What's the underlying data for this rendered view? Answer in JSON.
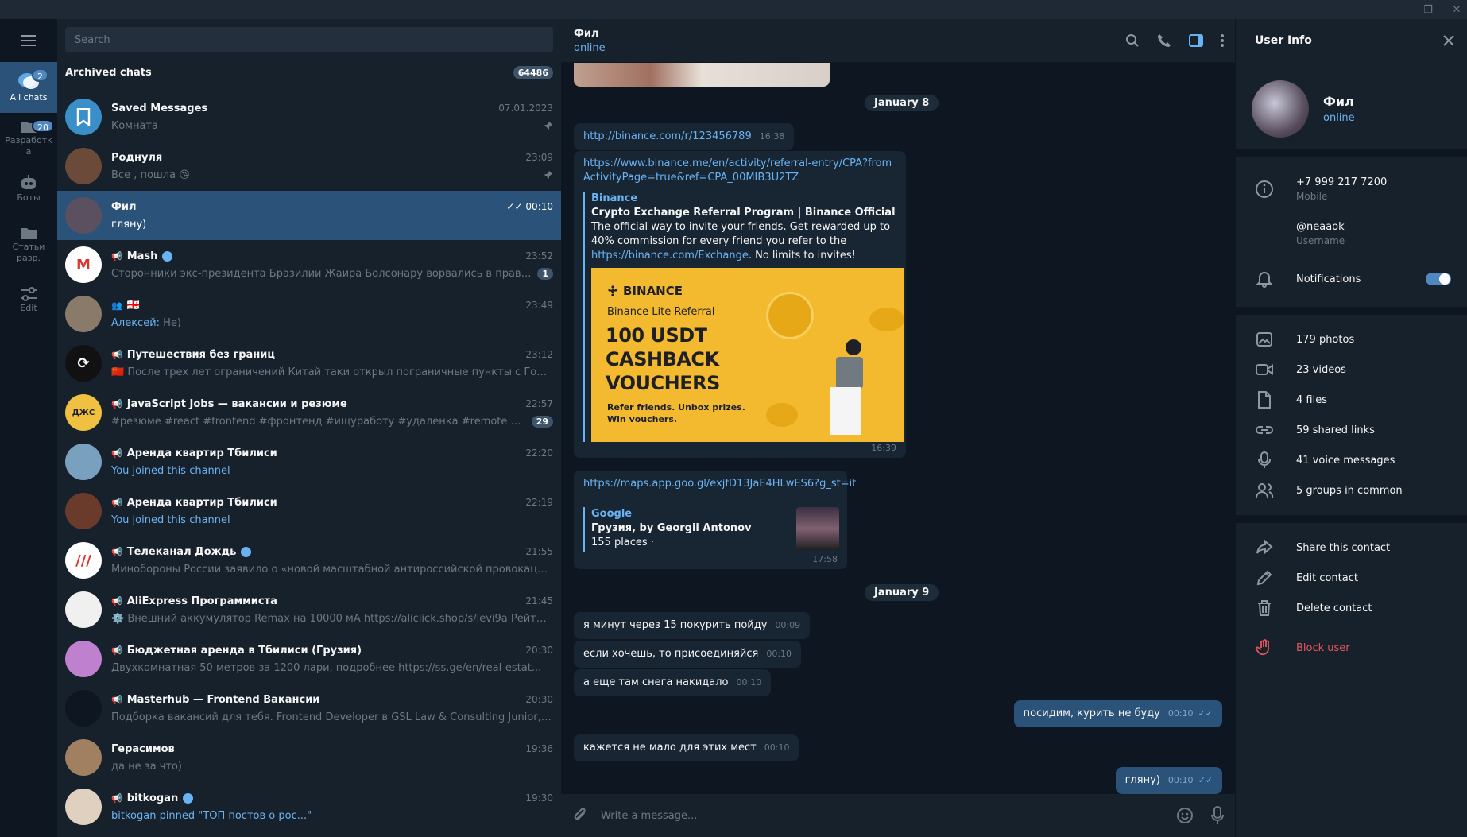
{
  "window": {
    "minimize": "–",
    "maximize": "❐",
    "close": "✕"
  },
  "folders": [
    {
      "label": "All chats",
      "badge": "2",
      "icon": "chats-icon",
      "active": true
    },
    {
      "label": "Разработк а",
      "badge": "20",
      "icon": "folder-icon"
    },
    {
      "label": "Боты",
      "badge": "",
      "icon": "bot-icon"
    },
    {
      "label": "Статьи разр.",
      "badge": "",
      "icon": "folder-icon"
    },
    {
      "label": "Edit",
      "badge": "",
      "icon": "sliders-icon"
    }
  ],
  "search": {
    "placeholder": "Search"
  },
  "archived": {
    "label": "Archived chats",
    "count": "64486"
  },
  "chats": [
    {
      "name": "Saved Messages",
      "time": "07.01.2023",
      "preview": "Комната",
      "pinned": true,
      "avatar_color": "#3a8fc9",
      "avatar_text": "",
      "icon": "bookmark-icon"
    },
    {
      "name": "Роднуля",
      "time": "23:09",
      "preview": "Все , пошла 😘",
      "pinned": true,
      "avatar_color": "#6b4a3a",
      "avatar_text": ""
    },
    {
      "name": "Фил",
      "time": "00:10",
      "preview": "гляну)",
      "selected": true,
      "avatar_color": "#5a5060",
      "avatar_text": "",
      "read": "✓✓"
    },
    {
      "name": "Mash",
      "time": "23:52",
      "preview": "Сторонники экс-президента Бразилии Жаира Болсонару ворвались в правите...",
      "badge": "1",
      "channel": true,
      "verified": true,
      "avatar_color": "#ffffff",
      "avatar_text": "M"
    },
    {
      "name": "🇬🇪",
      "time": "23:49",
      "preview_sender": "Алексей:",
      "preview": " Не)",
      "group": true,
      "avatar_color": "#8a7a6a",
      "avatar_text": ""
    },
    {
      "name": "Путешествия без границ",
      "time": "23:12",
      "preview": "🇨🇳 После трех лет ограничений Китай таки открыл пограничные пункты с Гонконго...",
      "channel": true,
      "avatar_color": "#111111",
      "avatar_text": "⟳"
    },
    {
      "name": "JavaScript Jobs — вакансии и резюме",
      "time": "22:57",
      "preview": "#резюме #react #frontend #фронтенд #ищуработу #удаленка #remote #fulltime ...",
      "badge": "29",
      "channel": true,
      "avatar_color": "#f0c040",
      "avatar_text": "ДЖС"
    },
    {
      "name": "Аренда квартир Тбилиси",
      "time": "22:20",
      "preview": "You joined this channel",
      "preview_blue": true,
      "channel": true,
      "avatar_color": "#7aa0c0",
      "avatar_text": ""
    },
    {
      "name": "Аренда квартир Тбилиси",
      "time": "22:19",
      "preview": "You joined this channel",
      "preview_blue": true,
      "channel": true,
      "avatar_color": "#6a3a2a",
      "avatar_text": ""
    },
    {
      "name": "Телеканал Дождь",
      "time": "21:55",
      "preview": "Минобороны России заявило о «новой масштабной антироссийской провокации», к...",
      "channel": true,
      "verified": true,
      "avatar_color": "#ffffff",
      "avatar_text": "///"
    },
    {
      "name": "AliExpress Программиста",
      "time": "21:45",
      "preview": "⚙️ Внешний аккумулятор Remax на 10000 мА   https://aliclick.shop/s/ievi9a  Рейтин...",
      "channel": true,
      "avatar_color": "#f0f0f0",
      "avatar_text": ""
    },
    {
      "name": "Бюджетная аренда в Тбилиси (Грузия)",
      "time": "20:30",
      "preview": "Двухкомнатная 50 метров за 1200 лари, подробнее https://ss.ge/en/real-estat...",
      "channel": true,
      "avatar_color": "#c080d0",
      "avatar_text": ""
    },
    {
      "name": "Masterhub — Frontend Вакансии",
      "time": "20:30",
      "preview": "Подборка вакансий для тебя.  Frontend Developer в GSL Law & Consulting Junior, Middl...",
      "channel": true,
      "avatar_color": "#0e1621",
      "avatar_text": ""
    },
    {
      "name": "Герасимов",
      "time": "19:36",
      "preview": "да не за что)",
      "avatar_color": "#a08060",
      "avatar_text": ""
    },
    {
      "name": "bitkogan",
      "time": "19:30",
      "preview": "bitkogan pinned \"ТОП постов о рос...\"",
      "preview_blue": true,
      "channel": true,
      "verified": true,
      "avatar_color": "#e0d0c0",
      "avatar_text": ""
    }
  ],
  "chat": {
    "name": "Фил",
    "status": "online",
    "date1": "January 8",
    "date2": "January 9",
    "m1": {
      "text": "http://binance.com/r/123456789",
      "time": "16:38"
    },
    "m2": {
      "url": "https://www.binance.me/en/activity/referral-entry/CPA?fromActivityPage=true&ref=CPA_00MIB3U2TZ",
      "site": "Binance",
      "title": "Crypto Exchange Referral Program | Binance Official",
      "desc1": "The official way to invite your friends. Get rewarded up to 40% commission for every friend you refer to the ",
      "desc_link": "https://binance.com/Exchange",
      "desc2": ". No limits to invites!",
      "banner_brand": "BINANCE",
      "banner_sub": "Binance Lite Referral",
      "banner_l1": "100 USDT",
      "banner_l2": "CASHBACK",
      "banner_l3": "VOUCHERS",
      "banner_f1": "Refer friends. Unbox prizes.",
      "banner_f2": "Win vouchers.",
      "time": "16:39"
    },
    "m3": {
      "url": "https://maps.app.goo.gl/exjfD13JaE4HLwES6?g_st=it",
      "site": "Google",
      "title": "Грузия, by Georgii Antonov",
      "desc": "155 places ·",
      "time": "17:58"
    },
    "m4": {
      "text": "я минут через 15 покурить пойду",
      "time": "00:09"
    },
    "m5": {
      "text": "если хочешь, то присоединяйся",
      "time": "00:10"
    },
    "m6": {
      "text": "а еще там снега накидало",
      "time": "00:10"
    },
    "m7": {
      "text": "посидим, курить не буду",
      "time": "00:10",
      "read": "✓✓"
    },
    "m8": {
      "text": "кажется не мало для этих мест",
      "time": "00:10"
    },
    "m9": {
      "text": "гляну)",
      "time": "00:10",
      "read": "✓✓"
    },
    "composer_placeholder": "Write a message..."
  },
  "info": {
    "title": "User Info",
    "name": "Фил",
    "status": "online",
    "phone": "+7 999 217 7200",
    "phone_label": "Mobile",
    "username": "@neaaok",
    "username_label": "Username",
    "notifications": "Notifications",
    "notifications_on": true,
    "media": [
      {
        "label": "179 photos",
        "icon": "photo-icon"
      },
      {
        "label": "23 videos",
        "icon": "video-icon"
      },
      {
        "label": "4 files",
        "icon": "file-icon"
      },
      {
        "label": "59 shared links",
        "icon": "link-icon"
      },
      {
        "label": "41 voice messages",
        "icon": "mic-icon"
      },
      {
        "label": "5 groups in common",
        "icon": "groups-icon"
      }
    ],
    "actions": [
      {
        "label": "Share this contact",
        "icon": "share-icon"
      },
      {
        "label": "Edit contact",
        "icon": "pencil-icon"
      },
      {
        "label": "Delete contact",
        "icon": "trash-icon"
      }
    ],
    "block": "Block user"
  },
  "colors": {
    "accent": "#6ab3f3",
    "selected": "#2b5278",
    "panel": "#17212b",
    "bg": "#0e1621",
    "danger": "#e5545c",
    "banner": "#f3ba2f"
  }
}
